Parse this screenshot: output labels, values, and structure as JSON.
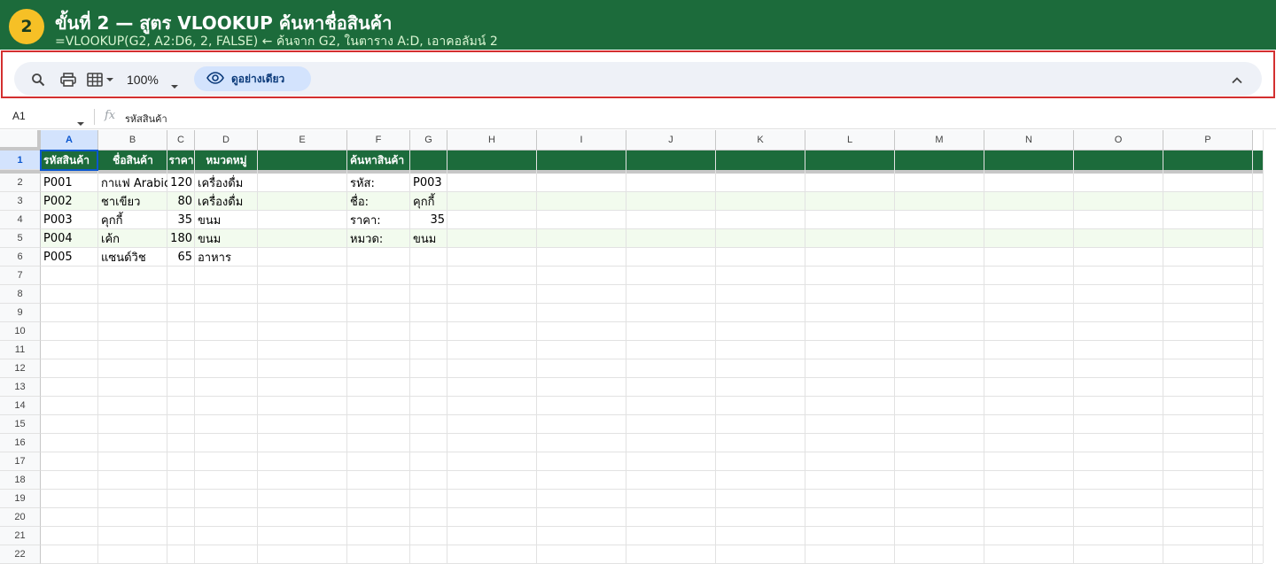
{
  "banner": {
    "step": "2",
    "title": "ขั้นที่ 2 — สูตร VLOOKUP ค้นหาชื่อสินค้า",
    "subtitle": "=VLOOKUP(G2, A2:D6, 2, FALSE)  ← ค้นจาก G2, ในตาราง A:D, เอาคอลัมน์ 2"
  },
  "toolbar": {
    "search_icon": "search-icon",
    "print_icon": "print-icon",
    "view_icon": "table-view-icon",
    "zoom": "100%",
    "preview_label": "ดูอย่างเดียว",
    "preview_icon": "eye-icon",
    "collapse_icon": "chevron-up-icon"
  },
  "formula_bar": {
    "cell_ref": "A1",
    "fx": "fx",
    "value": "รหัสสินค้า"
  },
  "columns": [
    "A",
    "B",
    "C",
    "D",
    "E",
    "F",
    "G",
    "H",
    "I",
    "J",
    "K",
    "L",
    "M",
    "N",
    "O",
    "P"
  ],
  "rows": [
    "1",
    "2",
    "3",
    "4",
    "5",
    "6",
    "7",
    "8",
    "9",
    "10",
    "11",
    "12",
    "13",
    "14",
    "15",
    "16",
    "17",
    "18",
    "19",
    "20",
    "21",
    "22"
  ],
  "sheet": {
    "header": {
      "A": "รหัสสินค้า",
      "B": "ชื่อสินค้า",
      "C": "ราคา",
      "D": "หมวดหมู่",
      "F": "ค้นหาสินค้า"
    },
    "products": [
      {
        "code": "P001",
        "name": "กาแฟ Arabica",
        "price": "120",
        "category": "เครื่องดื่ม"
      },
      {
        "code": "P002",
        "name": "ชาเขียว",
        "price": "80",
        "category": "เครื่องดื่ม"
      },
      {
        "code": "P003",
        "name": "คุกกี้",
        "price": "35",
        "category": "ขนม"
      },
      {
        "code": "P004",
        "name": "เค้ก",
        "price": "180",
        "category": "ขนม"
      },
      {
        "code": "P005",
        "name": "แซนด์วิช",
        "price": "65",
        "category": "อาหาร"
      }
    ],
    "lookup": [
      {
        "label": "รหัส:",
        "value": "P003"
      },
      {
        "label": "ชื่อ:",
        "value": "คุกกี้"
      },
      {
        "label": "ราคา:",
        "value": "35"
      },
      {
        "label": "หมวด:",
        "value": "ขนม"
      }
    ]
  },
  "colors": {
    "banner": "#1c6b3b",
    "badge": "#f6c026",
    "highlight_border": "#d32f2f",
    "band": "#f2fbee",
    "selection": "#0b57d0"
  }
}
